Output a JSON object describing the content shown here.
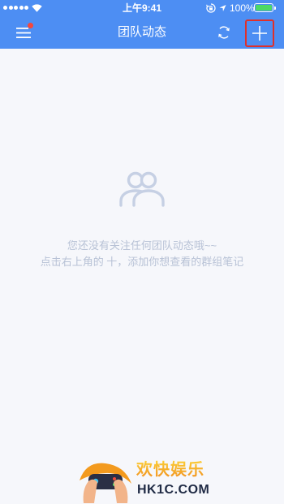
{
  "status_bar": {
    "signal_strength": 5,
    "time": "上午9:41",
    "battery_percent": "100%",
    "battery_level": 1.0,
    "icons": [
      "signal-dots-icon",
      "wifi-icon",
      "rotation-lock-icon",
      "location-arrow-icon",
      "battery-icon"
    ]
  },
  "nav": {
    "title": "团队动态",
    "menu_icon": "hamburger-menu-icon",
    "has_notification_dot": true,
    "refresh_icon": "refresh-icon",
    "add_icon": "plus-icon",
    "add_button_highlighted": true
  },
  "empty_state": {
    "icon": "group-people-icon",
    "line1": "您还没有关注任何团队动态哦~~",
    "line2": "点击右上角的 十，添加你想查看的群组笔记"
  },
  "watermark": {
    "icon": "hands-game-controller-logo",
    "title": "欢快娱乐",
    "subtitle": "HK1C.COM"
  },
  "colors": {
    "primary": "#4d8ef3",
    "background": "#f6f7fb",
    "empty_text": "#b8c2d6",
    "empty_icon": "#c6d0e4",
    "notification_dot": "#f5473b",
    "battery": "#4cd964",
    "highlight": "#e0302a",
    "watermark_title_start": "#fcd23a",
    "watermark_title_end": "#f08a1c",
    "watermark_subtitle": "#1f2a44"
  }
}
